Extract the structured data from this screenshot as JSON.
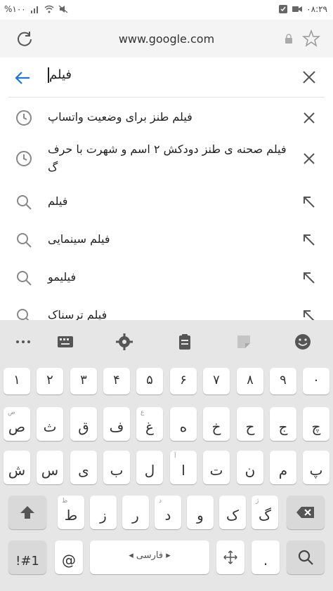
{
  "status_bar": {
    "time": "۰۸:۲۹",
    "battery": "%۱۰۰"
  },
  "url_bar": {
    "url": "www.google.com"
  },
  "search": {
    "query": "فیلم"
  },
  "suggestions": [
    {
      "text": "فیلم طنز برای وضعیت واتساپ",
      "type": "history"
    },
    {
      "text": "فیلم صحنه ی طنز دودکش ۲ اسم و شهرت با حرف گ",
      "type": "history"
    },
    {
      "text": "فیلم",
      "type": "search"
    },
    {
      "text": "فیلم سینمایی",
      "type": "search"
    },
    {
      "text": "فیلیمو",
      "type": "search"
    },
    {
      "text": "فیلم ترسناک",
      "type": "search"
    }
  ],
  "keyboard": {
    "toolbar_icons": [
      "more-icon",
      "keyboard-icon",
      "settings-icon",
      "clipboard-icon",
      "sticker-icon",
      "emoji-icon"
    ],
    "number_row": [
      "۱",
      "۲",
      "۳",
      "۴",
      "۵",
      "۶",
      "۷",
      "۸",
      "۹",
      "۰"
    ],
    "row2": [
      {
        "key": "ص",
        "hint": "ض"
      },
      {
        "key": "ث",
        "hint": ""
      },
      {
        "key": "ق",
        "hint": ""
      },
      {
        "key": "ف",
        "hint": ""
      },
      {
        "key": "غ",
        "hint": "ع"
      },
      {
        "key": "ه",
        "hint": ""
      },
      {
        "key": "خ",
        "hint": ""
      },
      {
        "key": "ح",
        "hint": ""
      },
      {
        "key": "ج",
        "hint": ""
      },
      {
        "key": "چ",
        "hint": ""
      }
    ],
    "row3": [
      {
        "key": "ش",
        "hint": ""
      },
      {
        "key": "س",
        "hint": ""
      },
      {
        "key": "ی",
        "hint": ""
      },
      {
        "key": "ب",
        "hint": ""
      },
      {
        "key": "ل",
        "hint": ""
      },
      {
        "key": "ا",
        "hint": "آ"
      },
      {
        "key": "ت",
        "hint": ""
      },
      {
        "key": "ن",
        "hint": ""
      },
      {
        "key": "م",
        "hint": ""
      },
      {
        "key": "پ",
        "hint": ""
      }
    ],
    "row4": [
      {
        "key": "ظ",
        "hint": ""
      },
      {
        "key": "ط",
        "hint": "ظ"
      },
      {
        "key": "ز",
        "hint": ""
      },
      {
        "key": "ر",
        "hint": ""
      },
      {
        "key": "ذ",
        "hint": ""
      },
      {
        "key": "د",
        "hint": "ذ"
      },
      {
        "key": "و",
        "hint": ""
      },
      {
        "key": "ک",
        "hint": ""
      },
      {
        "key": "گ",
        "hint": "ژ"
      }
    ],
    "symbols_label": "!#1",
    "at_label": "@",
    "space_label": "فارسی",
    "dot_label": "."
  },
  "colors": {
    "accent": "#1a73e8",
    "keyboard_bg": "#e6e6e6",
    "key_bg": "#ffffff"
  }
}
